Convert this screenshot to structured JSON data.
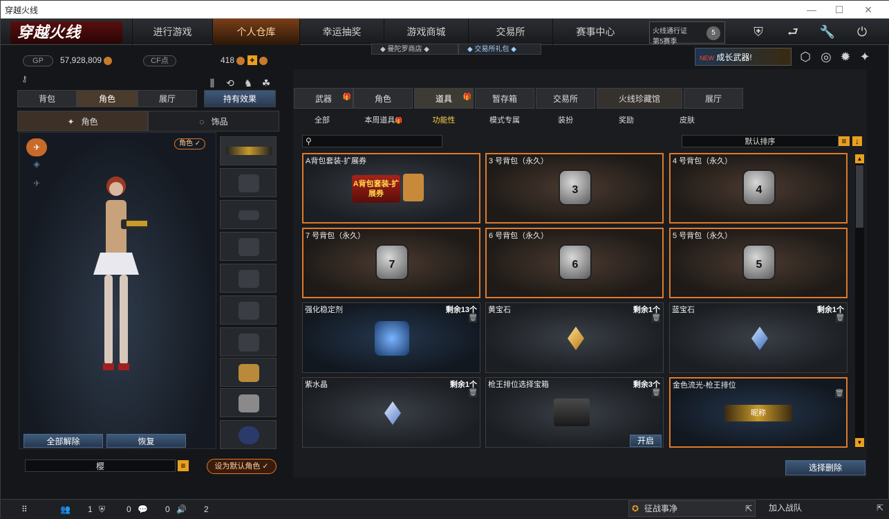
{
  "window": {
    "title": "穿越火线",
    "minimize": "—",
    "maximize": "☐",
    "close": "✕"
  },
  "logo": "穿越火线",
  "nav": {
    "tabs": [
      "进行游戏",
      "个人仓库",
      "幸运抽奖",
      "游戏商城",
      "交易所",
      "赛事中心"
    ],
    "active": "个人仓库",
    "subnav": [
      "曼陀罗商店",
      "交易所礼包"
    ]
  },
  "pass": {
    "line1": "火线通行证",
    "line2": "第5赛季",
    "rank": "5"
  },
  "promo": {
    "badge": "NEW",
    "text": "成长武器!"
  },
  "currency": {
    "gp_label": "GP",
    "gp_value": "57,928,809",
    "cf_label": "CF点",
    "cf_value": "418"
  },
  "left_tabs": [
    "背包",
    "角色",
    "展厅"
  ],
  "left_tab_active": "角色",
  "effects_button": "持有效果",
  "sub_tabs": [
    "角色",
    "饰品"
  ],
  "role_badge": "角色",
  "buttons": {
    "unequip_all": "全部解除",
    "restore": "恢复",
    "set_default": "设为默认角色"
  },
  "char_name": "樱",
  "right_tabs": [
    "武器",
    "角色",
    "道具",
    "暂存箱",
    "交易所",
    "火线珍藏馆",
    "展厅"
  ],
  "right_tab_active": "道具",
  "filter_tabs": [
    "全部",
    "本周道具",
    "功能性",
    "模式专属",
    "装扮",
    "奖励",
    "皮肤"
  ],
  "filter_active": "功能性",
  "sort_label": "默认排序",
  "items": [
    {
      "name": "A背包套装-扩展券",
      "count": "",
      "art": "A背包套装-扩展券"
    },
    {
      "name": "3 号背包（永久）",
      "count": "",
      "bag": "3"
    },
    {
      "name": "4 号背包（永久）",
      "count": "",
      "bag": "4"
    },
    {
      "name": "7 号背包（永久）",
      "count": "",
      "bag": "7"
    },
    {
      "name": "6 号背包（永久）",
      "count": "",
      "bag": "6"
    },
    {
      "name": "5 号背包（永久）",
      "count": "",
      "bag": "5"
    },
    {
      "name": "强化稳定剂",
      "count": "剩余13个"
    },
    {
      "name": "黄宝石",
      "count": "剩余1个"
    },
    {
      "name": "蓝宝石",
      "count": "剩余1个"
    },
    {
      "name": "紫水晶",
      "count": "剩余1个"
    },
    {
      "name": "枪王排位选择宝箱",
      "count": "剩余3个",
      "open": "开启"
    },
    {
      "name": "金色流光-枪王排位",
      "count": "",
      "tag": "昵称"
    }
  ],
  "delete_button": "选择删除",
  "bottom": {
    "stat1": "1",
    "stat2": "0",
    "stat3": "0",
    "stat4": "2",
    "zhanzhan": "征战事净",
    "join": "加入战队"
  },
  "colors": {
    "accent_orange": "#e07a2a",
    "blue_button": "#3f5a7a",
    "active_filter": "#ffd24a"
  }
}
